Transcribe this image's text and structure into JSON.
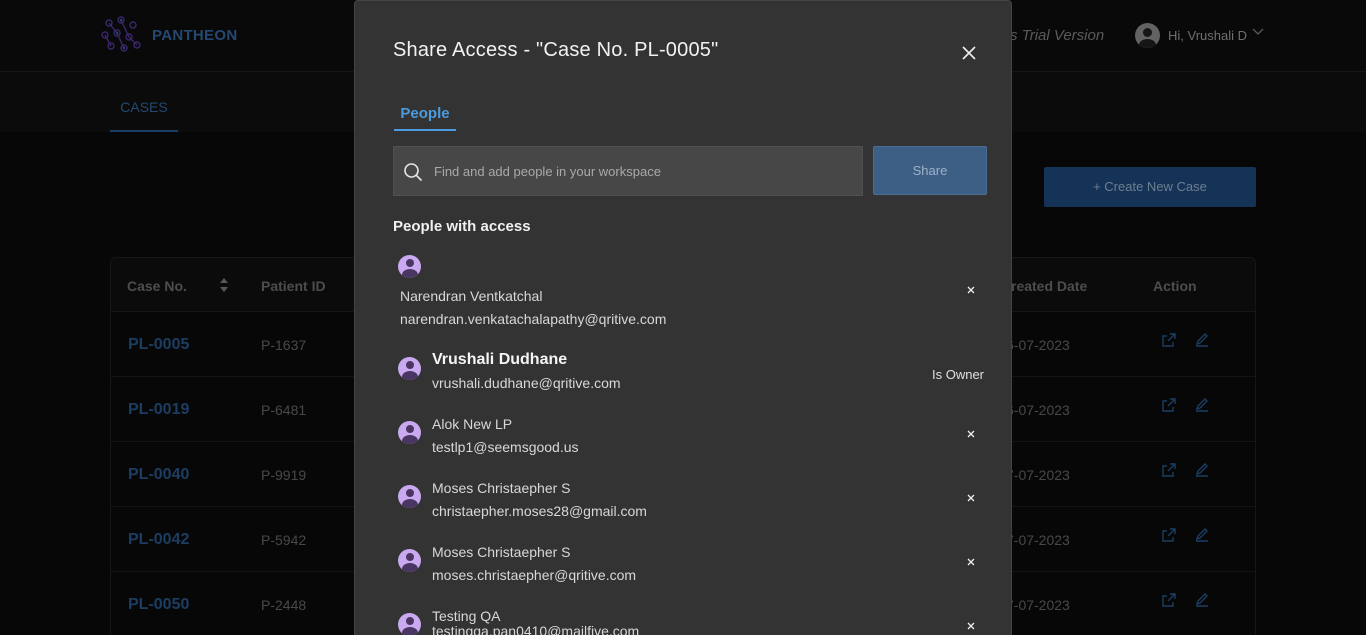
{
  "app": {
    "brand": "PANTHEON",
    "trial_text": "s Trial Version",
    "user_greeting": "Hi, Vrushali D",
    "tab": "CASES",
    "create_button": "+ Create New Case",
    "table": {
      "headers": {
        "case_no": "Case No.",
        "patient_id": "Patient ID",
        "created_date": "reated Date",
        "action": "Action"
      },
      "rows": [
        {
          "case_no": "PL-0005",
          "patient_id": "P-1637",
          "created_date": "6-07-2023"
        },
        {
          "case_no": "PL-0019",
          "patient_id": "P-6481",
          "created_date": "6-07-2023"
        },
        {
          "case_no": "PL-0040",
          "patient_id": "P-9919",
          "created_date": "7-07-2023"
        },
        {
          "case_no": "PL-0042",
          "patient_id": "P-5942",
          "created_date": "7-07-2023"
        },
        {
          "case_no": "PL-0050",
          "patient_id": "P-2448",
          "created_date": "7-07-2023"
        }
      ]
    }
  },
  "modal": {
    "title": "Share Access - \"Case No. PL-0005\"",
    "tab": "People",
    "search_placeholder": "Find and add people in your workspace",
    "share_button": "Share",
    "section_title": "People with access",
    "owner_tag": "Is Owner",
    "people": [
      {
        "name": "Narendran Ventkatchal",
        "email": "narendran.venkatachalapathy@qritive.com"
      },
      {
        "name": "Vrushali Dudhane",
        "email": "vrushali.dudhane@qritive.com",
        "owner": true
      },
      {
        "name": "Alok New LP",
        "email": "testlp1@seemsgood.us"
      },
      {
        "name": "Moses Christaepher S",
        "email": "christaepher.moses28@gmail.com"
      },
      {
        "name": "Moses Christaepher S",
        "email": "moses.christaepher@qritive.com"
      },
      {
        "name": "Testing QA",
        "email": "testingqa.pan0410@mailfive.com"
      }
    ]
  },
  "colors": {
    "accent": "#4a9be0",
    "brand": "#3a6fb0",
    "modal_bg": "#333333",
    "avatar": "#c9a9ef"
  }
}
